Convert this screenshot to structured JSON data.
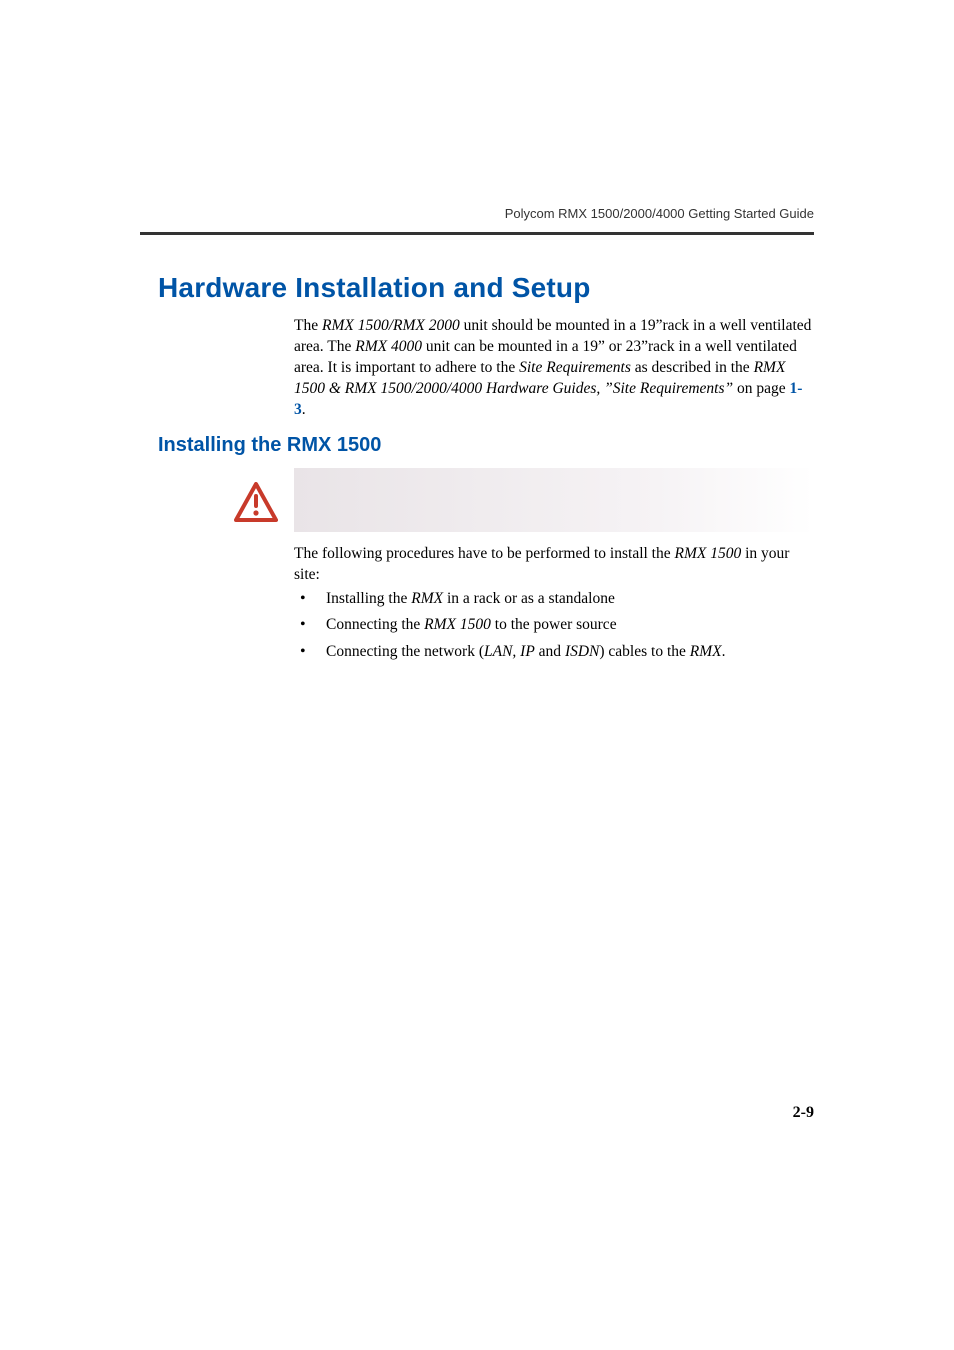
{
  "header": {
    "running": "Polycom RMX 1500/2000/4000 Getting Started Guide"
  },
  "h1": "Hardware Installation and Setup",
  "intro": {
    "t1": "The ",
    "i1": "RMX 1500/RMX 2000",
    "t2": " unit should be mounted in a 19”rack in a well ventilated area. The ",
    "i2": "RMX 4000",
    "t3": " unit can be mounted in a 19” or 23”rack in a well ventilated area. It is important to adhere to the ",
    "i3": "Site Requirements",
    "t4": " as described in the ",
    "i4": "RMX 1500 & RMX 1500/2000/4000 Hardware Guides, ”Site Requirements”",
    "t5": " on page ",
    "link": "1-3",
    "t6": "."
  },
  "h2": "Installing the RMX 1500",
  "after": {
    "t1": "The following procedures have to be performed to install the ",
    "i1": "RMX 1500",
    "t2": " in your site:"
  },
  "bullets": {
    "b1": {
      "t1": "Installing the ",
      "i1": "RMX",
      "t2": " in a rack or as a standalone"
    },
    "b2": {
      "t1": "Connecting the ",
      "i1": "RMX 1500",
      "t2": " to the power source"
    },
    "b3": {
      "t1": "Connecting the network (",
      "i1": "LAN, IP",
      "t2": " and ",
      "i2": "ISDN",
      "t3": ") cables to the ",
      "i3": "RMX",
      "t4": "."
    }
  },
  "pagenum": "2-9"
}
